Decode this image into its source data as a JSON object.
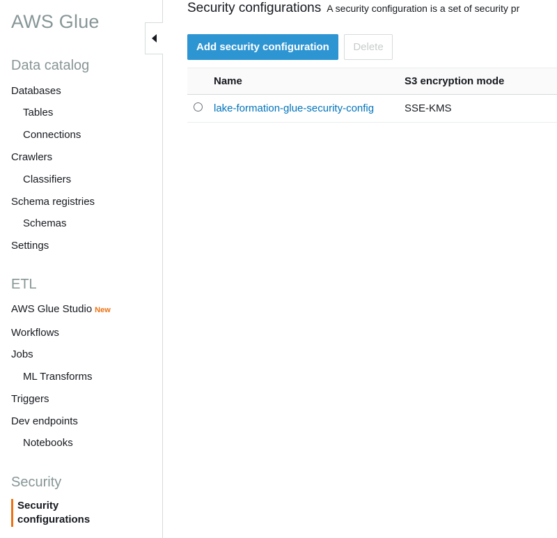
{
  "sidebar": {
    "brand": "AWS Glue",
    "sections": {
      "data_catalog": "Data catalog",
      "etl": "ETL",
      "security": "Security"
    },
    "items": {
      "databases": "Databases",
      "tables": "Tables",
      "connections": "Connections",
      "crawlers": "Crawlers",
      "classifiers": "Classifiers",
      "schema_registries": "Schema registries",
      "schemas": "Schemas",
      "settings": "Settings",
      "glue_studio": "AWS Glue Studio",
      "glue_studio_badge": "New",
      "workflows": "Workflows",
      "jobs": "Jobs",
      "ml_transforms": "ML Transforms",
      "triggers": "Triggers",
      "dev_endpoints": "Dev endpoints",
      "notebooks": "Notebooks",
      "security_configurations_line1": "Security",
      "security_configurations_line2": "configurations"
    },
    "collapse_icon": "caret-left-icon"
  },
  "main": {
    "title": "Security configurations",
    "description": "A security configuration is a set of security pr",
    "add_button": "Add security configuration",
    "delete_button": "Delete",
    "table": {
      "columns": [
        "Name",
        "S3 encryption mode"
      ],
      "rows": [
        {
          "name": "lake-formation-glue-security-config",
          "s3_mode": "SSE-KMS"
        }
      ]
    }
  },
  "colors": {
    "accent": "#ec7211",
    "primary_button": "#2e95d3",
    "link": "#0073bb",
    "muted": "#879596"
  }
}
